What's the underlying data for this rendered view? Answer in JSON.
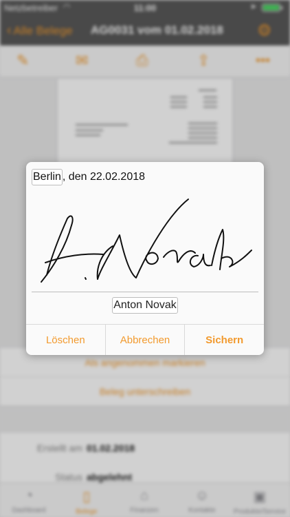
{
  "status_bar": {
    "carrier": "Netzbetreiber",
    "time": "11:00",
    "battery_level": 1.0
  },
  "nav": {
    "back_label": "Alle Belege",
    "title": "AG0031 vom 01.02.2018"
  },
  "actions": {
    "mark_accepted": "Als angenommen markieren",
    "sign_document": "Beleg unterschreiben"
  },
  "details": [
    {
      "label": "Erstellt am",
      "value": "01.02.2018"
    },
    {
      "label": "Status",
      "value": "abgelehnt"
    }
  ],
  "tabs": [
    {
      "label": "Dashboard",
      "active": false
    },
    {
      "label": "Belege",
      "active": true
    },
    {
      "label": "Finanzen",
      "active": false
    },
    {
      "label": "Kontakte",
      "active": false
    },
    {
      "label": "Produkte/Service",
      "active": false
    }
  ],
  "dialog": {
    "place": "Berlin",
    "date_text": ", den 22.02.2018",
    "signer_name": "Anton Novak",
    "delete_label": "Löschen",
    "cancel_label": "Abbrechen",
    "save_label": "Sichern"
  },
  "colors": {
    "accent": "#f29a2e",
    "bar": "#595959",
    "battery": "#4cd964"
  }
}
